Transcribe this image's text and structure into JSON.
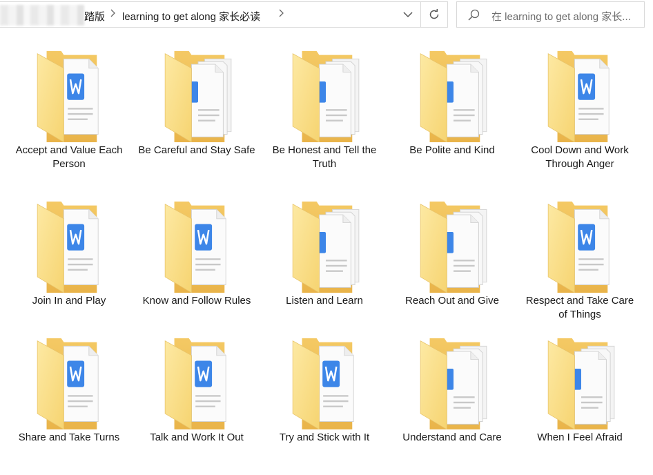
{
  "breadcrumb": {
    "parent_fragment": "踏版",
    "current_folder": "learning to get along 家长必读"
  },
  "search": {
    "placeholder": "在 learning to get along 家长..."
  },
  "icons": {
    "breadcrumb_separator": "chevron-right-icon",
    "history_dropdown": "chevron-down-icon",
    "refresh": "refresh-icon",
    "search": "search-icon",
    "item_icon": "folder-with-word-document-icon"
  },
  "colors": {
    "folder_yellow": "#f7d779",
    "folder_dark": "#e8b84a",
    "word_blue": "#3d86e8"
  },
  "folders": [
    {
      "name": "Accept and Value Each Person",
      "variant": "word"
    },
    {
      "name": "Be Careful and Stay Safe",
      "variant": "stack"
    },
    {
      "name": "Be Honest and Tell the Truth",
      "variant": "stack"
    },
    {
      "name": "Be Polite and Kind",
      "variant": "stack"
    },
    {
      "name": "Cool Down and Work Through Anger",
      "variant": "word"
    },
    {
      "name": "Join In and Play",
      "variant": "word"
    },
    {
      "name": "Know and Follow Rules",
      "variant": "word"
    },
    {
      "name": "Listen and Learn",
      "variant": "stack"
    },
    {
      "name": "Reach Out and Give",
      "variant": "stack"
    },
    {
      "name": "Respect and Take Care of Things",
      "variant": "word"
    },
    {
      "name": "Share and Take Turns",
      "variant": "word"
    },
    {
      "name": "Talk and Work It Out",
      "variant": "word"
    },
    {
      "name": "Try and Stick with It",
      "variant": "word"
    },
    {
      "name": "Understand and Care",
      "variant": "stack"
    },
    {
      "name": "When I Feel Afraid",
      "variant": "stack"
    }
  ]
}
